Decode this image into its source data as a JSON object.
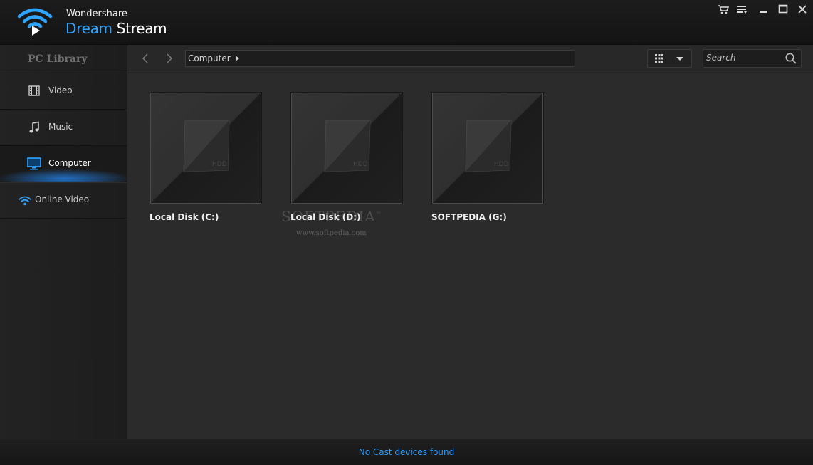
{
  "app": {
    "brand_top": "Wondershare",
    "brand_accent": "Dream",
    "brand_main": "Stream",
    "accent_color": "#2fa4ff"
  },
  "window_controls": [
    {
      "name": "cart-icon"
    },
    {
      "name": "menu-icon"
    },
    {
      "name": "minimize-icon"
    },
    {
      "name": "maximize-icon"
    },
    {
      "name": "close-icon"
    }
  ],
  "sidebar": {
    "header": "PC Library",
    "items": [
      {
        "label": "Video",
        "icon": "film-icon",
        "active": false
      },
      {
        "label": "Music",
        "icon": "music-note-icon",
        "active": false
      },
      {
        "label": "Computer",
        "icon": "monitor-icon",
        "active": true
      },
      {
        "label": "Online Video",
        "icon": "wifi-icon",
        "active": false
      }
    ]
  },
  "toolbar": {
    "breadcrumb": "Computer",
    "search_placeholder": "Search",
    "view_mode_icon": "grid-icon"
  },
  "drives": [
    {
      "label": "Local Disk (C:)",
      "icon_text": "HDD"
    },
    {
      "label": "Local Disk (D:)",
      "icon_text": "HDD"
    },
    {
      "label": "SOFTPEDIA (G:)",
      "icon_text": "HDD"
    }
  ],
  "watermark": {
    "text": "SOFTPEDIA",
    "mark": "™",
    "url": "www.softpedia.com"
  },
  "status": {
    "text": "No Cast devices found",
    "color": "#2b9cff"
  }
}
